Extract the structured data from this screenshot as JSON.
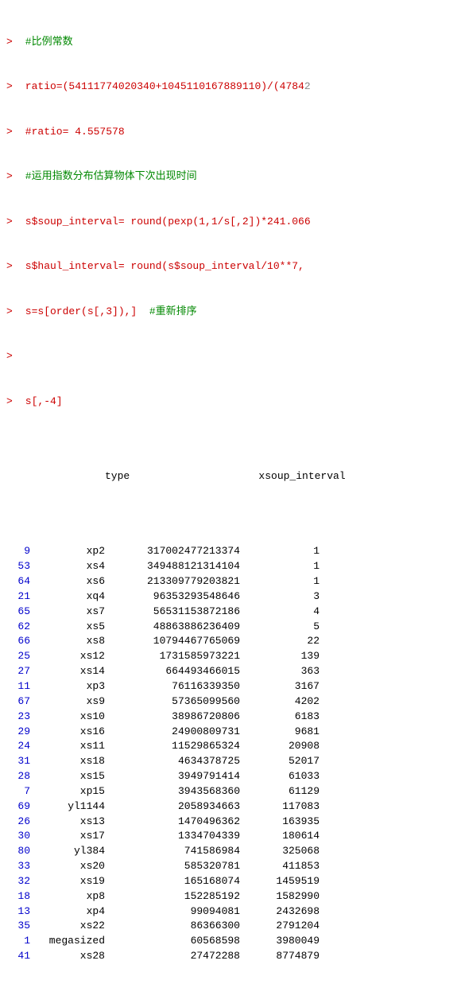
{
  "console": {
    "lines": [
      {
        "type": "comment",
        "prompt": ">",
        "text": " #比例常数"
      },
      {
        "type": "code",
        "prompt": ">",
        "text": " ratio=(54111774020340+1045110167889110)/(4784"
      },
      {
        "type": "code",
        "prompt": ">",
        "text": " #ratio= 4.557578"
      },
      {
        "type": "comment",
        "prompt": ">",
        "text": " #运用指数分布估算物体下次出现时间"
      },
      {
        "type": "code",
        "prompt": ">",
        "text": " s$soup_interval= round(pexp(1,1/s[,2])*241.066"
      },
      {
        "type": "code",
        "prompt": ">",
        "text": " s$haul_interval= round(s$soup_interval/10**7,"
      },
      {
        "type": "code",
        "prompt": ">",
        "text": " s=s[order(s[,3]),]  #重新排序"
      },
      {
        "type": "blank",
        "prompt": ">",
        "text": ""
      },
      {
        "type": "code",
        "prompt": ">",
        "text": " s[,-4]"
      }
    ],
    "table_header": {
      "col1": "type",
      "col2": "x",
      "col3": "soup_interval"
    },
    "rows": [
      {
        "rownum": "9",
        "type": "xp2",
        "x": "317002477213374",
        "soup": "1"
      },
      {
        "rownum": "53",
        "type": "xs4",
        "x": "349488121314104",
        "soup": "1"
      },
      {
        "rownum": "64",
        "type": "xs6",
        "x": "213309779203821",
        "soup": "1"
      },
      {
        "rownum": "21",
        "type": "xq4",
        "x": "96353293548646",
        "soup": "3"
      },
      {
        "rownum": "65",
        "type": "xs7",
        "x": "56531153872186",
        "soup": "4"
      },
      {
        "rownum": "62",
        "type": "xs5",
        "x": "48863886236409",
        "soup": "5"
      },
      {
        "rownum": "66",
        "type": "xs8",
        "x": "10794467765069",
        "soup": "22"
      },
      {
        "rownum": "25",
        "type": "xs12",
        "x": "1731585973221",
        "soup": "139"
      },
      {
        "rownum": "27",
        "type": "xs14",
        "x": "664493466015",
        "soup": "363"
      },
      {
        "rownum": "11",
        "type": "xp3",
        "x": "76116339350",
        "soup": "3167"
      },
      {
        "rownum": "67",
        "type": "xs9",
        "x": "57365099560",
        "soup": "4202"
      },
      {
        "rownum": "23",
        "type": "xs10",
        "x": "38986720806",
        "soup": "6183"
      },
      {
        "rownum": "29",
        "type": "xs16",
        "x": "24900809731",
        "soup": "9681"
      },
      {
        "rownum": "24",
        "type": "xs11",
        "x": "11529865324",
        "soup": "20908"
      },
      {
        "rownum": "31",
        "type": "xs18",
        "x": "4634378725",
        "soup": "52017"
      },
      {
        "rownum": "28",
        "type": "xs15",
        "x": "3949791414",
        "soup": "61033"
      },
      {
        "rownum": "7",
        "type": "xp15",
        "x": "3943568360",
        "soup": "61129"
      },
      {
        "rownum": "69",
        "type": "yl1144",
        "x": "2058934663",
        "soup": "117083"
      },
      {
        "rownum": "26",
        "type": "xs13",
        "x": "1470496362",
        "soup": "163935"
      },
      {
        "rownum": "30",
        "type": "xs17",
        "x": "1334704339",
        "soup": "180614"
      },
      {
        "rownum": "80",
        "type": "yl384",
        "x": "741586984",
        "soup": "325068"
      },
      {
        "rownum": "33",
        "type": "xs20",
        "x": "585320781",
        "soup": "411853"
      },
      {
        "rownum": "32",
        "type": "xs19",
        "x": "165168074",
        "soup": "1459519"
      },
      {
        "rownum": "18",
        "type": "xp8",
        "x": "152285192",
        "soup": "1582990"
      },
      {
        "rownum": "13",
        "type": "xp4",
        "x": "99094081",
        "soup": "2432698"
      },
      {
        "rownum": "35",
        "type": "xs22",
        "x": "86366300",
        "soup": "2791204"
      },
      {
        "rownum": "1",
        "type": "megasized",
        "x": "60568598",
        "soup": "3980049"
      },
      {
        "rownum": "41",
        "type": "xs28",
        "x": "27472288",
        "soup": "8774879"
      }
    ]
  }
}
